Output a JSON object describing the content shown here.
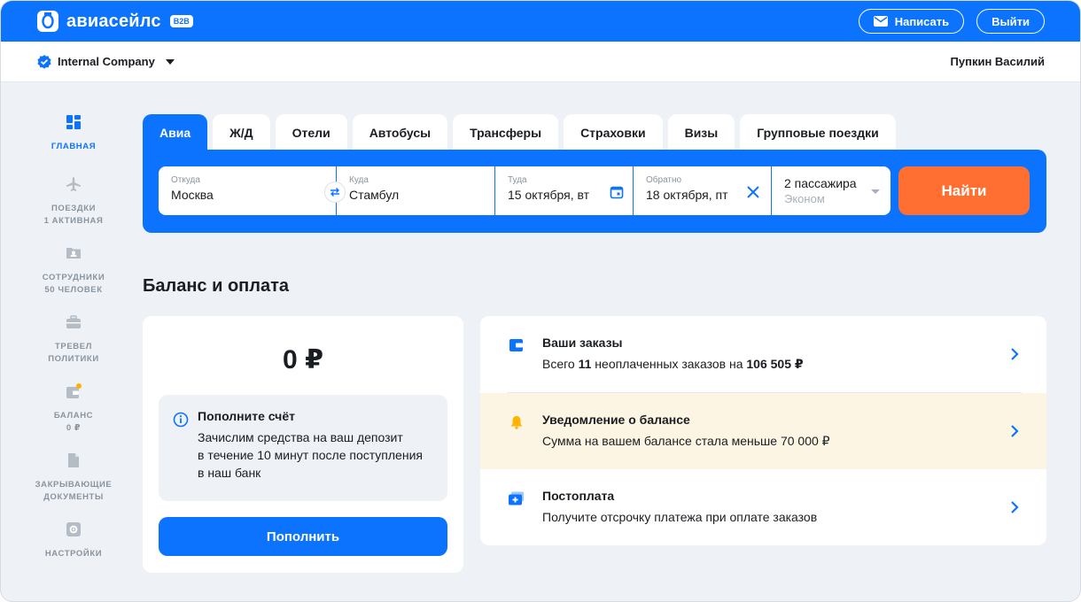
{
  "header": {
    "logo_text": "авиасейлс",
    "logo_badge": "B2B",
    "write_label": "Написать",
    "logout_label": "Выйти"
  },
  "subheader": {
    "company": "Internal Company",
    "user": "Пупкин Василий"
  },
  "sidebar": {
    "items": [
      {
        "icon": "dashboard-icon",
        "line1": "ГЛАВНАЯ",
        "line2": ""
      },
      {
        "icon": "airplane-icon",
        "line1": "ПОЕЗДКИ",
        "line2": "1 АКТИВНАЯ"
      },
      {
        "icon": "id-card-icon",
        "line1": "СОТРУДНИКИ",
        "line2": "50 ЧЕЛОВЕК"
      },
      {
        "icon": "briefcase-icon",
        "line1": "ТРЕВЕЛ",
        "line2": "ПОЛИТИКИ"
      },
      {
        "icon": "wallet-icon",
        "line1": "БАЛАНС",
        "line2": "0 ₽"
      },
      {
        "icon": "document-icon",
        "line1": "ЗАКРЫВАЮЩИЕ",
        "line2": "ДОКУМЕНТЫ"
      },
      {
        "icon": "settings-icon",
        "line1": "НАСТРОЙКИ",
        "line2": ""
      }
    ]
  },
  "tabs": [
    "Авиа",
    "Ж/Д",
    "Отели",
    "Автобусы",
    "Трансферы",
    "Страховки",
    "Визы",
    "Групповые поездки"
  ],
  "search": {
    "from_label": "Откуда",
    "from_value": "Москва",
    "to_label": "Куда",
    "to_value": "Стамбул",
    "there_label": "Туда",
    "there_value": "15 октября, вт",
    "back_label": "Обратно",
    "back_value": "18 октября, пт",
    "passengers": "2 пассажира",
    "class": "Эконом",
    "find_label": "Найти"
  },
  "balance": {
    "section_title": "Баланс и оплата",
    "amount": "0 ₽",
    "topup_title": "Пополните счёт",
    "topup_text_1": "Зачислим средства на ваш депозит",
    "topup_text_2": "в течение 10 минут после поступления",
    "topup_text_3": "в наш банк",
    "topup_button": "Пополнить"
  },
  "list": {
    "orders_title": "Ваши заказы",
    "orders_prefix": "Всего ",
    "orders_count": "11",
    "orders_middle": " неоплаченных заказов на ",
    "orders_sum": "106 505 ₽",
    "notify_title": "Уведомление о балансе",
    "notify_text": "Сумма на вашем балансе стала меньше 70 000 ₽",
    "postpay_title": "Постоплата",
    "postpay_text": "Получите отсрочку платежа при оплате заказов"
  },
  "colors": {
    "brand_blue": "#0c73fe",
    "accent_orange": "#ff6f32",
    "notice_bg": "#fdf5e4",
    "bell_yellow": "#ffb300"
  }
}
